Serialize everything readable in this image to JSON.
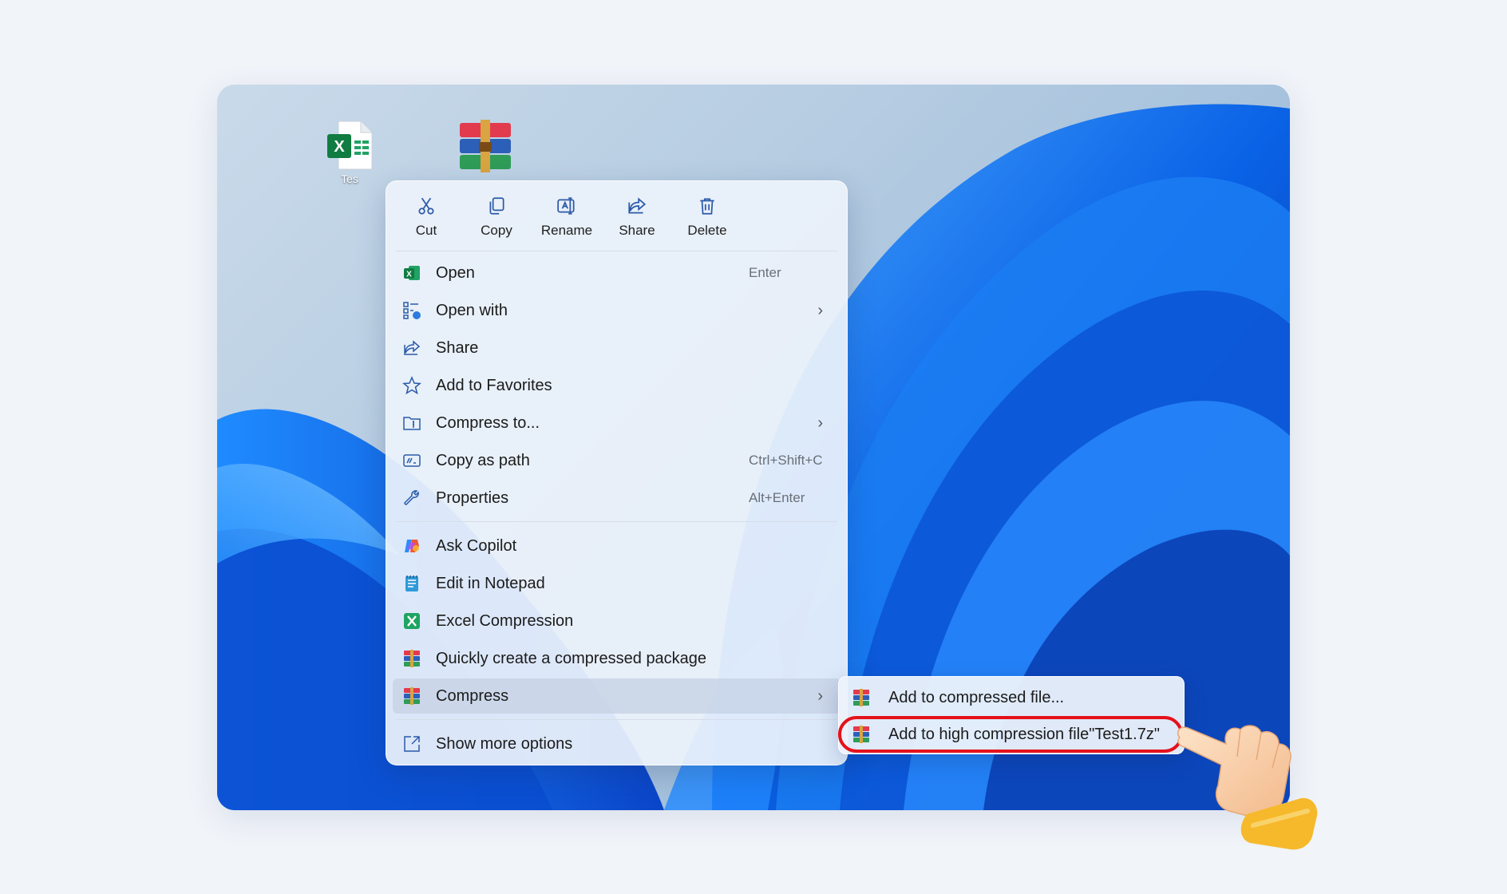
{
  "desktop": {
    "icons": [
      {
        "name": "excel-file",
        "label": "Tes"
      },
      {
        "name": "winrar-archive",
        "label": ""
      }
    ]
  },
  "context_menu": {
    "quick_actions": [
      {
        "label": "Cut",
        "icon": "scissors-icon"
      },
      {
        "label": "Copy",
        "icon": "copy-icon"
      },
      {
        "label": "Rename",
        "icon": "rename-icon"
      },
      {
        "label": "Share",
        "icon": "share-icon"
      },
      {
        "label": "Delete",
        "icon": "trash-icon"
      }
    ],
    "items": [
      {
        "label": "Open",
        "shortcut": "Enter",
        "icon": "excel-icon"
      },
      {
        "label": "Open with",
        "icon": "open-with-icon",
        "submenu": true
      },
      {
        "label": "Share",
        "icon": "share-icon"
      },
      {
        "label": "Add to Favorites",
        "icon": "star-icon"
      },
      {
        "label": "Compress to...",
        "icon": "compress-folder-icon",
        "submenu": true
      },
      {
        "label": "Copy as path",
        "shortcut": "Ctrl+Shift+C",
        "icon": "path-icon"
      },
      {
        "label": "Properties",
        "shortcut": "Alt+Enter",
        "icon": "wrench-icon"
      },
      {
        "label": "Ask Copilot",
        "icon": "copilot-icon"
      },
      {
        "label": "Edit in Notepad",
        "icon": "notepad-icon"
      },
      {
        "label": "Excel Compression",
        "icon": "excel-compress-icon"
      },
      {
        "label": "Quickly create a compressed package",
        "icon": "winrar-icon"
      },
      {
        "label": "Compress",
        "icon": "winrar-icon",
        "submenu": true,
        "highlighted": true
      },
      {
        "label": "Show more options",
        "icon": "more-options-icon"
      }
    ]
  },
  "submenu": {
    "items": [
      {
        "label": "Add to compressed file...",
        "icon": "winrar-icon"
      },
      {
        "label": "Add to high compression file\"Test1.7z\"",
        "icon": "winrar-icon",
        "highlighted": true
      }
    ]
  },
  "colors": {
    "accent_ring": "#e5121b",
    "wallpaper_blue": "#0a5fe0",
    "menu_bg": "#ecf2fb"
  }
}
